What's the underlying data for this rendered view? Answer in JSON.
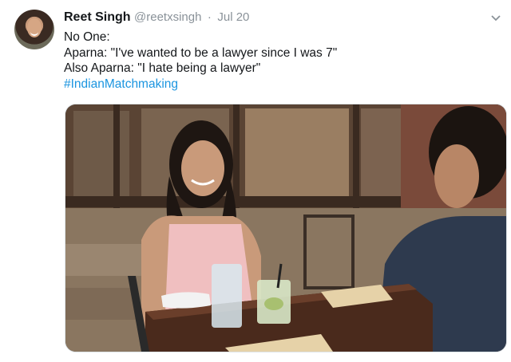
{
  "tweet": {
    "author_name": "Reet Singh",
    "handle": "@reetxsingh",
    "separator": "·",
    "date": "Jul 20",
    "lines": [
      "No One:",
      "Aparna: \"I've wanted to be a lawyer since I was 7\"",
      "Also Aparna: \"I hate being a lawyer\""
    ],
    "hashtag": "#IndianMatchmaking"
  },
  "icons": {
    "menu": "chevron-down-icon"
  },
  "colors": {
    "link": "#1b95e0",
    "muted": "#8a9299",
    "text": "#14171a"
  }
}
